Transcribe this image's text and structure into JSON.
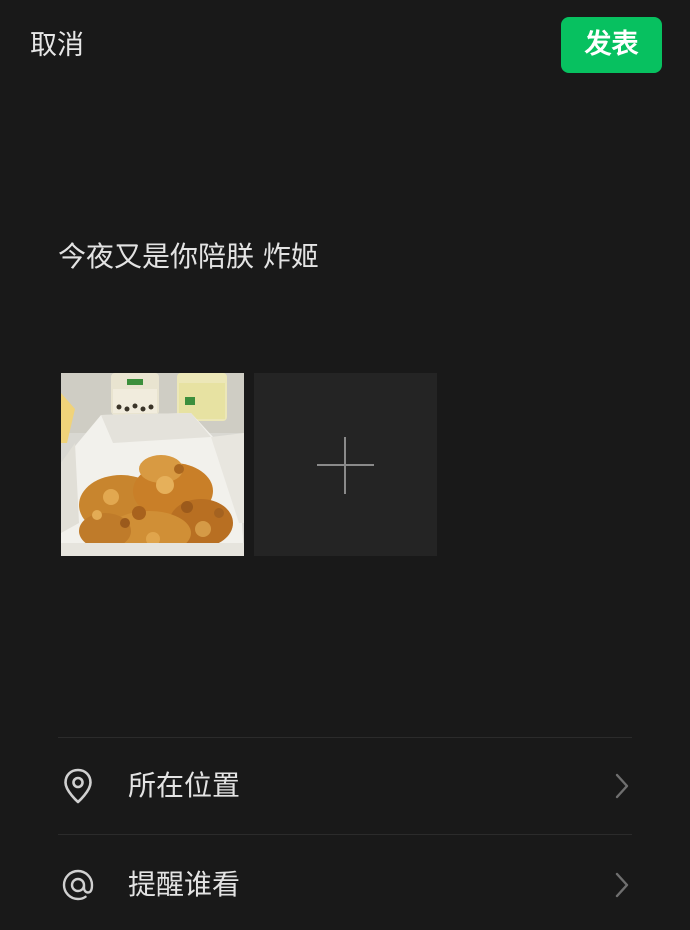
{
  "header": {
    "cancel_label": "取消",
    "publish_label": "发表",
    "accent_color": "#07c160"
  },
  "post": {
    "text": "今夜又是你陪朕 炸姬"
  },
  "media": {
    "thumbnails": [
      {
        "icon": "fried-chicken-photo"
      }
    ],
    "add_icon": "plus-icon"
  },
  "options": [
    {
      "icon": "location-pin-icon",
      "label": "所在位置"
    },
    {
      "icon": "at-sign-icon",
      "label": "提醒谁看"
    }
  ]
}
